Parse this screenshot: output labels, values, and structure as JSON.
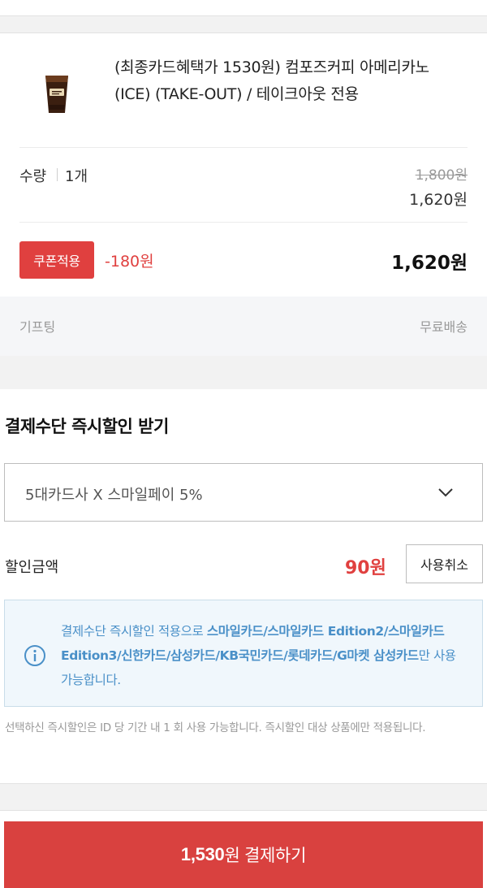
{
  "product": {
    "title": "(최종카드혜택가 1530원) 컴포즈커피 아메리카노(ICE) (TAKE-OUT) / 테이크아웃 전용",
    "thumbnail_icon": "iced-coffee-cup-icon"
  },
  "quantity": {
    "label": "수량",
    "value": "1개",
    "original_price": "1,800원",
    "sale_price": "1,620원"
  },
  "coupon": {
    "button_label": "쿠폰적용",
    "discount": "-180원",
    "total": "1,620원"
  },
  "gift": {
    "label": "기프팅",
    "shipping": "무료배송"
  },
  "payment": {
    "title": "결제수단 즉시할인 받기",
    "selected_option": "5대카드사 X 스마일페이 5%",
    "discount_label": "할인금액",
    "discount_amount": "90원",
    "cancel_label": "사용취소",
    "info_prefix": "결제수단 즉시할인 적용으로 ",
    "info_cards": "스마일카드/스마일카드 Edition2/스마일카드 Edition3/신한카드/삼성카드/KB국민카드/롯데카드/G마켓 삼성카드",
    "info_suffix": "만 사용 가능합니다.",
    "notice": "선택하신 즉시할인은 ID 당 기간 내 1 회 사용 가능합니다. 즉시할인 대상 상품에만 적용됩니다."
  },
  "checkout": {
    "amount": "1,530",
    "label": "원 결제하기"
  },
  "colors": {
    "accent_red": "#e0403f",
    "info_blue": "#4a90c8",
    "info_bg": "#f0f7fc"
  }
}
